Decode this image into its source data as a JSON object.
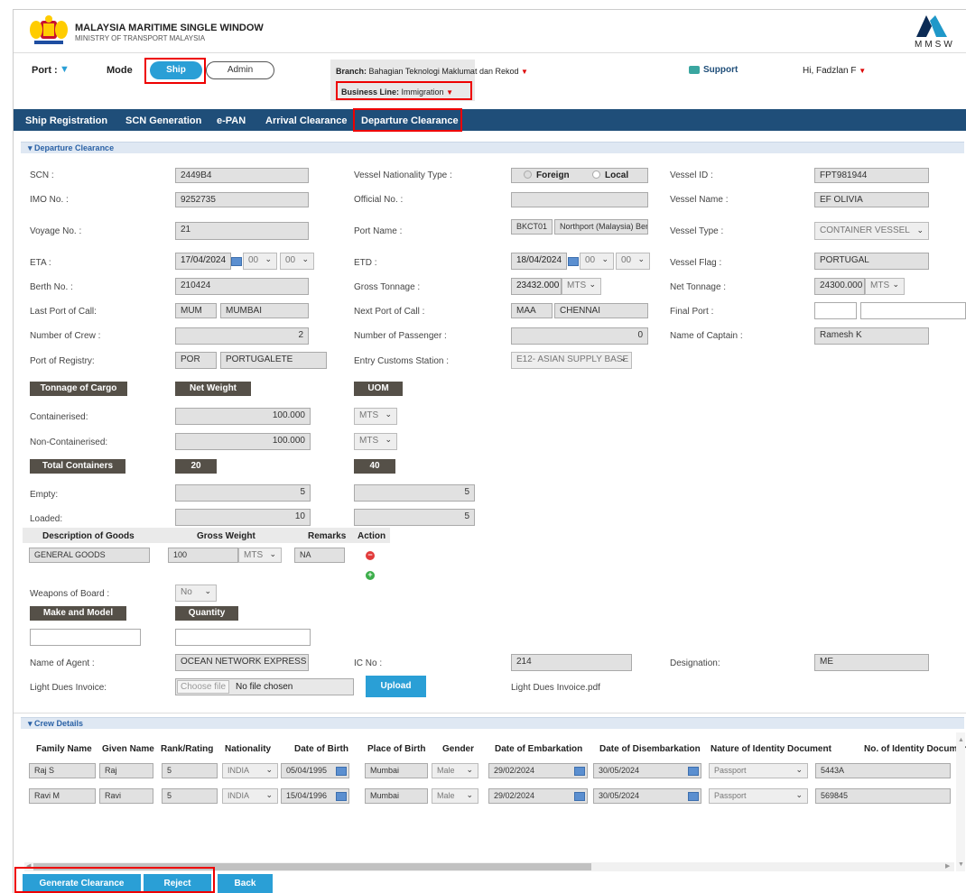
{
  "app": {
    "title": "MALAYSIA MARITIME SINGLE WINDOW",
    "subtitle": "MINISTRY OF TRANSPORT MALAYSIA",
    "logo_text": "MMSW",
    "brand_color": "#1f4e79"
  },
  "topbar": {
    "port_label": "Port :",
    "mode_label": "Mode",
    "mode_ship": "Ship",
    "mode_admin": "Admin",
    "branch_label": "Branch:",
    "branch_value": "Bahagian Teknologi Maklumat dan Rekod",
    "business_label": "Business Line:",
    "business_value": "Immigration",
    "support": "Support",
    "user": "Hi, Fadzlan F"
  },
  "nav": {
    "items": [
      "Ship Registration",
      "SCN Generation",
      "e-PAN",
      "Arrival Clearance",
      "Departure Clearance"
    ]
  },
  "section1": "Departure Clearance",
  "form": {
    "scn_l": "SCN :",
    "scn": "2449B4",
    "vnt_l": "Vessel Nationality Type :",
    "foreign": "Foreign",
    "local": "Local",
    "vid_l": "Vessel ID :",
    "vid": "FPT981944",
    "imo_l": "IMO No. :",
    "imo": "9252735",
    "off_l": "Official No. :",
    "off": "",
    "vname_l": "Vessel Name :",
    "vname": "EF OLIVIA",
    "voy_l": "Voyage No. :",
    "voy": "21",
    "pname_l": "Port Name :",
    "pcode": "BKCT01",
    "pname": "Northport (Malaysia) Ber",
    "vtype_l": "Vessel Type :",
    "vtype": "CONTAINER VESSEL",
    "eta_l": "ETA :",
    "eta": "17/04/2024",
    "eta_h": "00",
    "eta_m": "00",
    "etd_l": "ETD :",
    "etd": "18/04/2024",
    "etd_h": "00",
    "etd_m": "00",
    "flag_l": "Vessel Flag :",
    "flag": "PORTUGAL",
    "berth_l": "Berth No. :",
    "berth": "210424",
    "gt_l": "Gross Tonnage :",
    "gt": "23432.000",
    "gt_u": "MTS",
    "nt_l": "Net Tonnage :",
    "nt": "24300.000",
    "nt_u": "MTS",
    "lpc_l": "Last Port of Call:",
    "lpc_code": "MUM",
    "lpc": "MUMBAI",
    "npc_l": "Next Port of Call :",
    "npc_code": "MAA",
    "npc": "CHENNAI",
    "fp_l": "Final Port :",
    "crew_l": "Number of Crew :",
    "crew": "2",
    "pax_l": "Number of Passenger :",
    "pax": "0",
    "cap_l": "Name of Captain :",
    "cap": "Ramesh K",
    "reg_l": "Port of Registry:",
    "reg_code": "POR",
    "reg": "PORTUGALETE",
    "ecs_l": "Entry Customs Station :",
    "ecs": "E12- ASIAN SUPPLY BASE",
    "toc": "Tonnage of Cargo",
    "nw": "Net Weight",
    "uom": "UOM",
    "cont_l": "Containerised:",
    "cont": "100.000",
    "cont_u": "MTS",
    "ncont_l": "Non-Containerised:",
    "ncont": "100.000",
    "ncont_u": "MTS",
    "tc": "Total Containers",
    "c20": "20",
    "c40": "40",
    "empty_l": "Empty:",
    "empty20": "5",
    "empty40": "5",
    "loaded_l": "Loaded:",
    "loaded20": "10",
    "loaded40": "5",
    "g_h1": "Description of Goods",
    "g_h2": "Gross Weight",
    "g_h3": "Remarks",
    "g_h4": "Action",
    "g_desc": "GENERAL GOODS",
    "g_wt": "100",
    "g_u": "MTS",
    "g_rem": "NA",
    "weap_l": "Weapons of Board :",
    "weap": "No",
    "mm": "Make and Model",
    "qty": "Quantity",
    "agent_l": "Name of Agent :",
    "agent": "OCEAN NETWORK EXPRESS",
    "ic_l": "IC No :",
    "ic": "214",
    "des_l": "Designation:",
    "des": "ME",
    "ldi_l": "Light Dues Invoice:",
    "choose": "Choose file",
    "nofile": "No file chosen",
    "upload": "Upload",
    "pdf": "Light Dues Invoice.pdf"
  },
  "section2": "Crew Details",
  "crew": {
    "headers": [
      "Family Name",
      "Given Name",
      "Rank/Rating",
      "Nationality",
      "Date of Birth",
      "Place of Birth",
      "Gender",
      "Date of Embarkation",
      "Date of Disembarkation",
      "Nature of Identity Document",
      "No. of Identity Document"
    ],
    "rows": [
      [
        "Raj S",
        "Raj",
        "5",
        "INDIA",
        "05/04/1995",
        "Mumbai",
        "Male",
        "29/02/2024",
        "30/05/2024",
        "Passport",
        "5443A"
      ],
      [
        "Ravi M",
        "Ravi",
        "5",
        "INDIA",
        "15/04/1996",
        "Mumbai",
        "Male",
        "29/02/2024",
        "30/05/2024",
        "Passport",
        "569845"
      ]
    ]
  },
  "actions": {
    "generate": "Generate Clearance",
    "reject": "Reject",
    "back": "Back"
  }
}
